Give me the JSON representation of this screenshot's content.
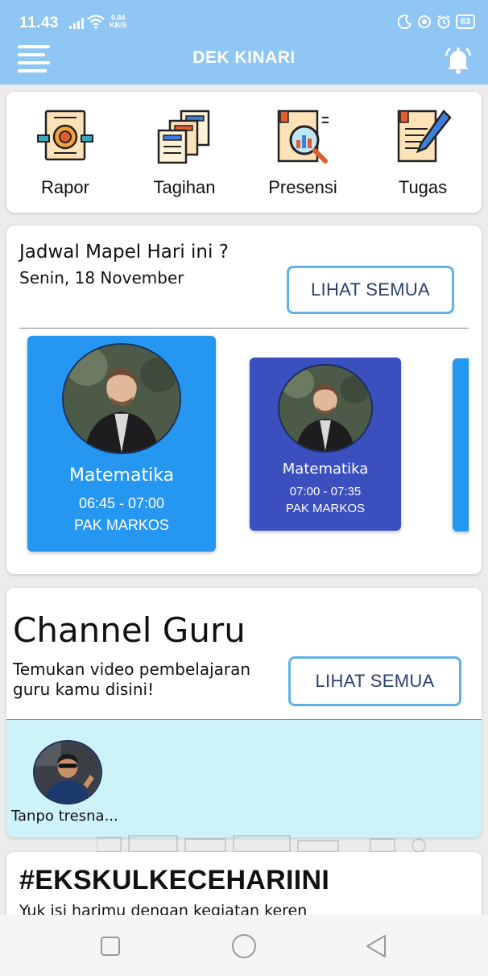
{
  "status_bar": {
    "time": "11.43",
    "net_speed_value": "0.84",
    "net_speed_unit": "KB/S",
    "battery": "83"
  },
  "app_bar": {
    "title": "DEK KINARI"
  },
  "quick_menu": [
    {
      "label": "Rapor",
      "icon": "certificate-icon"
    },
    {
      "label": "Tagihan",
      "icon": "bills-icon"
    },
    {
      "label": "Presensi",
      "icon": "report-magnifier-icon"
    },
    {
      "label": "Tugas",
      "icon": "assignment-pen-icon"
    }
  ],
  "schedule": {
    "title": "Jadwal Mapel Hari ini ?",
    "date": "Senin, 18 November",
    "see_all": "LIHAT SEMUA",
    "items": [
      {
        "subject": "Matematika",
        "time": "06:45 - 07:00",
        "teacher": "PAK MARKOS"
      },
      {
        "subject": "Matematika",
        "time": "07:00 - 07:35",
        "teacher": "PAK MARKOS"
      }
    ]
  },
  "channel": {
    "title": "Channel Guru",
    "description": "Temukan video pembelajaran guru kamu disini!",
    "see_all": "LIHAT SEMUA",
    "videos": [
      {
        "title": "Tanpo tresna..."
      }
    ]
  },
  "ekskul": {
    "title": "#EKSKULKECEHARIINI",
    "subtitle": "Yuk isi harimu dengan kegiatan keren"
  },
  "colors": {
    "app_bar": "#8fc6f3",
    "schedule_card_primary": "#2697f0",
    "schedule_card_secondary": "#3b4fbf",
    "button_border": "#5fb1e6",
    "channel_strip": "#cdf2f8"
  }
}
